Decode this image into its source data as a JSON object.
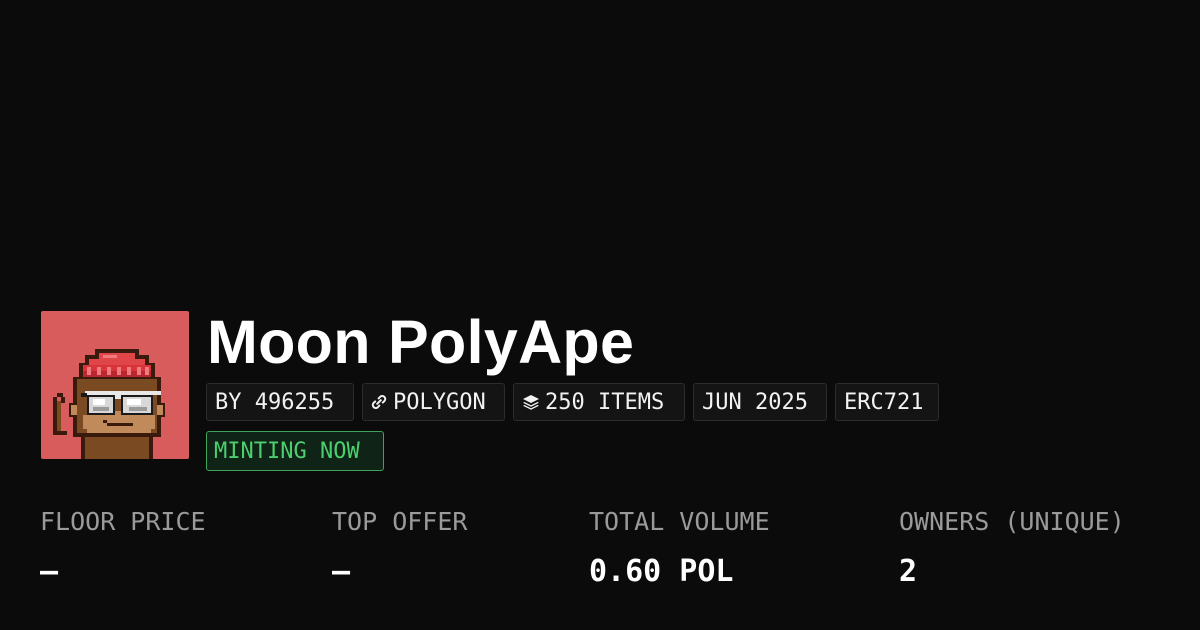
{
  "collection": {
    "name": "Moon PolyApe",
    "avatar_icon": "pixel-ape-avatar",
    "avatar_bg": "#d95c5c"
  },
  "tags": {
    "creator": "BY 496255",
    "chain": "POLYGON",
    "chain_icon": "polygon-link-icon",
    "items": "250 ITEMS",
    "items_icon": "layers-icon",
    "date": "JUN 2025",
    "standard": "ERC721"
  },
  "status": {
    "label": "MINTING NOW",
    "color": "#4ccf6e"
  },
  "stats": {
    "floor_price_label": "FLOOR PRICE",
    "floor_price_value": "–",
    "top_offer_label": "TOP OFFER",
    "top_offer_value": "–",
    "total_volume_label": "TOTAL VOLUME",
    "total_volume_value": "0.60 POL",
    "owners_label": "OWNERS (UNIQUE)",
    "owners_value": "2"
  }
}
